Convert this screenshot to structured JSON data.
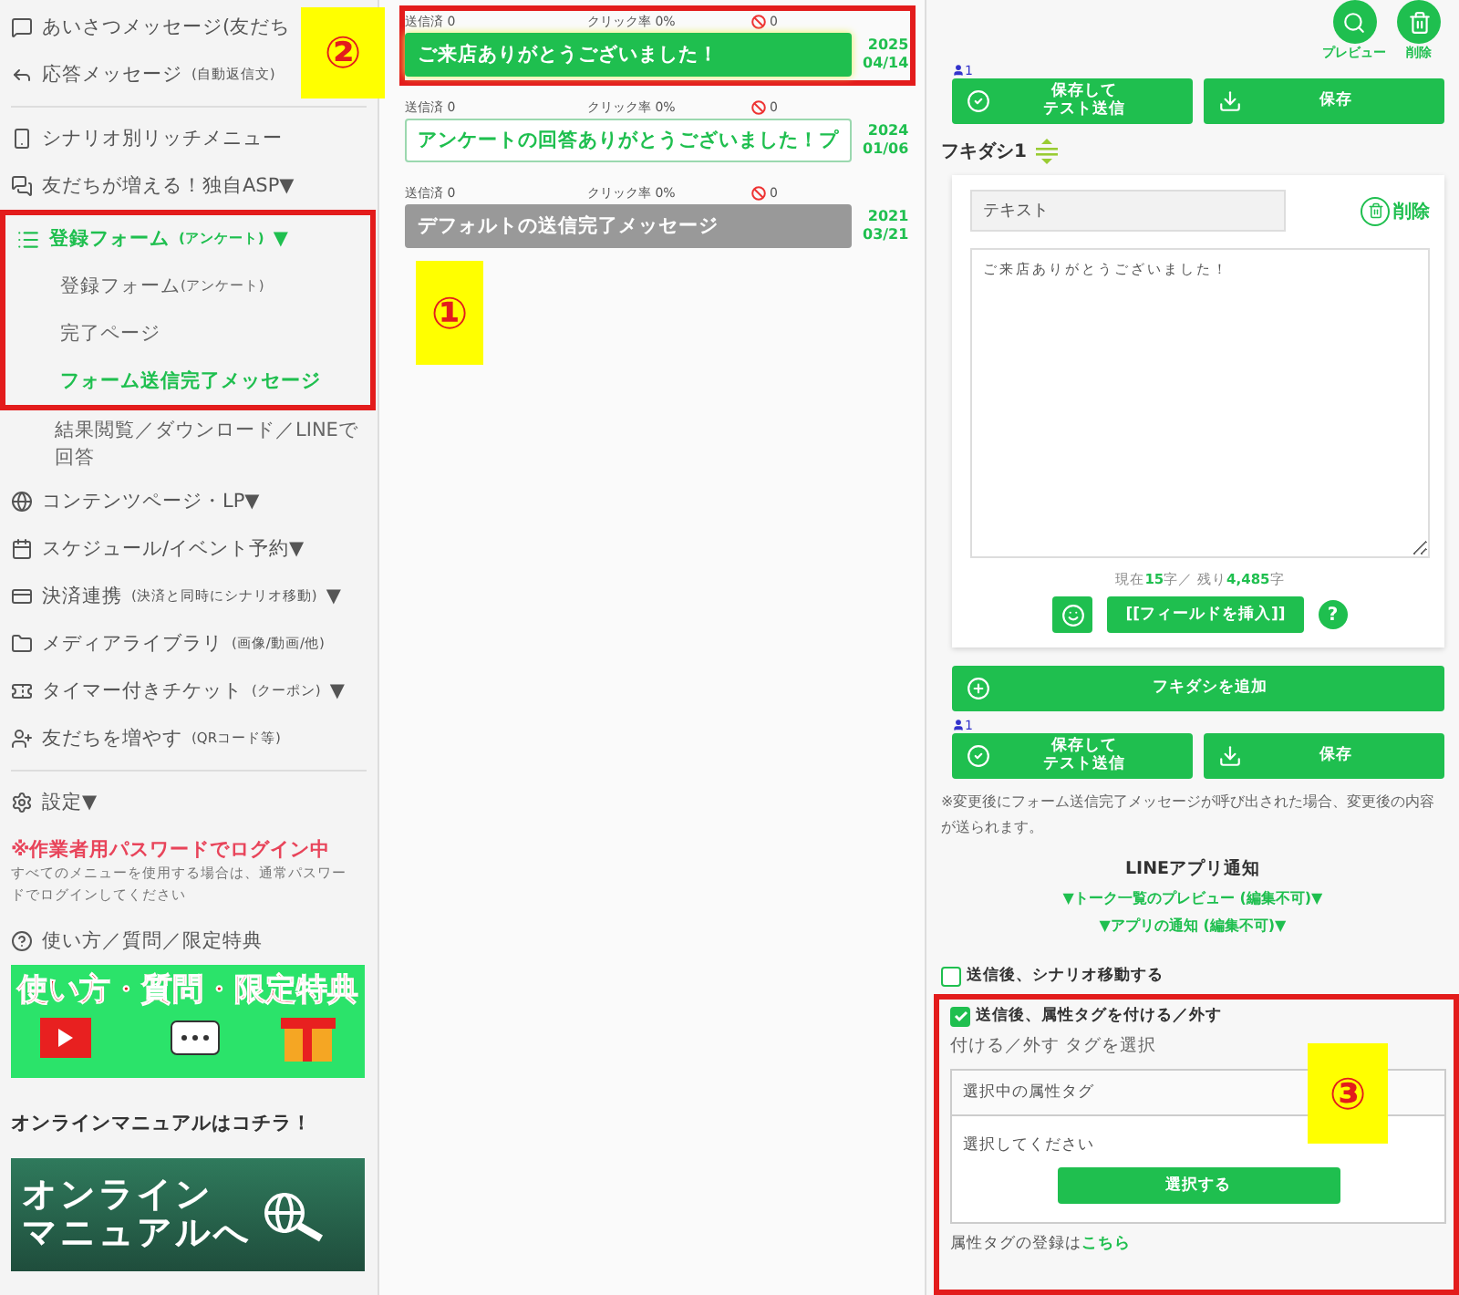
{
  "sidebar": {
    "items": [
      {
        "label": "あいさつメッセージ(友だち"
      },
      {
        "label": "応答メッセージ",
        "sub": "(自動返信文)"
      },
      {
        "label": "シナリオ別リッチメニュー"
      },
      {
        "label": "友だちが増える！独自ASP▼"
      }
    ],
    "form_group": {
      "highlighted": true,
      "title": "登録フォーム",
      "title_sub": "(アンケート)",
      "caret": "▼",
      "active": true,
      "children": [
        {
          "label": "登録フォーム",
          "sub": "(アンケート)",
          "selected": false
        },
        {
          "label": "完了ページ",
          "selected": false
        },
        {
          "label": "フォーム送信完了メッセージ",
          "selected": true
        }
      ]
    },
    "after_group": {
      "label": "結果閲覧／ダウンロード／LINEで回答"
    },
    "items_more": [
      {
        "label": "コンテンツページ・LP▼"
      },
      {
        "label": "スケジュール/イベント予約▼"
      },
      {
        "label": "決済連携",
        "sub": "(決済と同時にシナリオ移動)",
        "caret": "▼"
      },
      {
        "label": "メディアライブラリ",
        "sub": "(画像/動画/他)"
      },
      {
        "label": "タイマー付きチケット",
        "sub": "(クーポン)",
        "caret": "▼"
      },
      {
        "label": "友だちを増やす",
        "sub": "(QRコード等)"
      }
    ],
    "settings": "設定▼",
    "warning": {
      "title": "※作業者用パスワードでログイン中",
      "note": "すべてのメニューを使用する場合は、通常パスワードでログインしてください"
    },
    "help": "使い方／質問／限定特典",
    "help_banner": "使い方・質問・限定特典",
    "manual_heading": "オンラインマニュアルはコチラ！",
    "manual_banner": [
      "オンライン",
      "マニュアルへ"
    ]
  },
  "messages": [
    {
      "sent": "送信済 0",
      "click": "クリック率 0%",
      "blocked": "0",
      "title": "ご来店ありがとうございました！",
      "kind": "active",
      "highlighted": true,
      "year": "2025",
      "date": "04/14"
    },
    {
      "sent": "送信済 0",
      "click": "クリック率 0%",
      "blocked": "0",
      "title": "アンケートの回答ありがとうございました！プ",
      "kind": "outline",
      "highlighted": false,
      "year": "2024",
      "date": "01/06"
    },
    {
      "sent": "送信済 0",
      "click": "クリック率 0%",
      "blocked": "0",
      "title": "デフォルトの送信完了メッセージ",
      "kind": "default",
      "highlighted": false,
      "year": "2021",
      "date": "03/21"
    }
  ],
  "editor": {
    "top_actions": [
      "プレビュー",
      "削除"
    ],
    "user_count": "1",
    "test_button": [
      "保存して",
      "テスト送信"
    ],
    "save_button": "保存",
    "bubble_title": "フキダシ1",
    "bubble": {
      "type": "テキスト",
      "delete": "削除",
      "text": "ご来店ありがとうございました！",
      "counter": "現在**15**字／ 残り**4,485**字",
      "insert_field": "[[フィールドを挿入]]",
      "help": "?"
    },
    "add_bubble": "フキダシを追加",
    "user_count_2": "1",
    "test_button_2": [
      "保存して",
      "テスト送信"
    ],
    "save_button_2": "保存",
    "note": "※変更後にフォーム送信完了メッセージが呼び出された場合、変更後の内容が送られます。",
    "notify_heading": "LINEアプリ通知",
    "notify_links": [
      "▼トーク一覧のプレビュー (編集不可)▼",
      "▼アプリの通知 (編集不可)▼"
    ],
    "scenario_move": {
      "label": "送信後、シナリオ移動する",
      "checked": false
    },
    "tag_section": {
      "highlighted": true,
      "checkbox": {
        "label": "送信後、属性タグを付ける／外す",
        "checked": true
      },
      "caption": "付ける／外す タグを選択",
      "header": "選択中の属性タグ",
      "placeholder": "選択してください",
      "button": "選択する",
      "footer": "属性タグの登録は",
      "footer_link": "こちら"
    }
  },
  "annotations": [
    "②",
    "①",
    "③"
  ]
}
